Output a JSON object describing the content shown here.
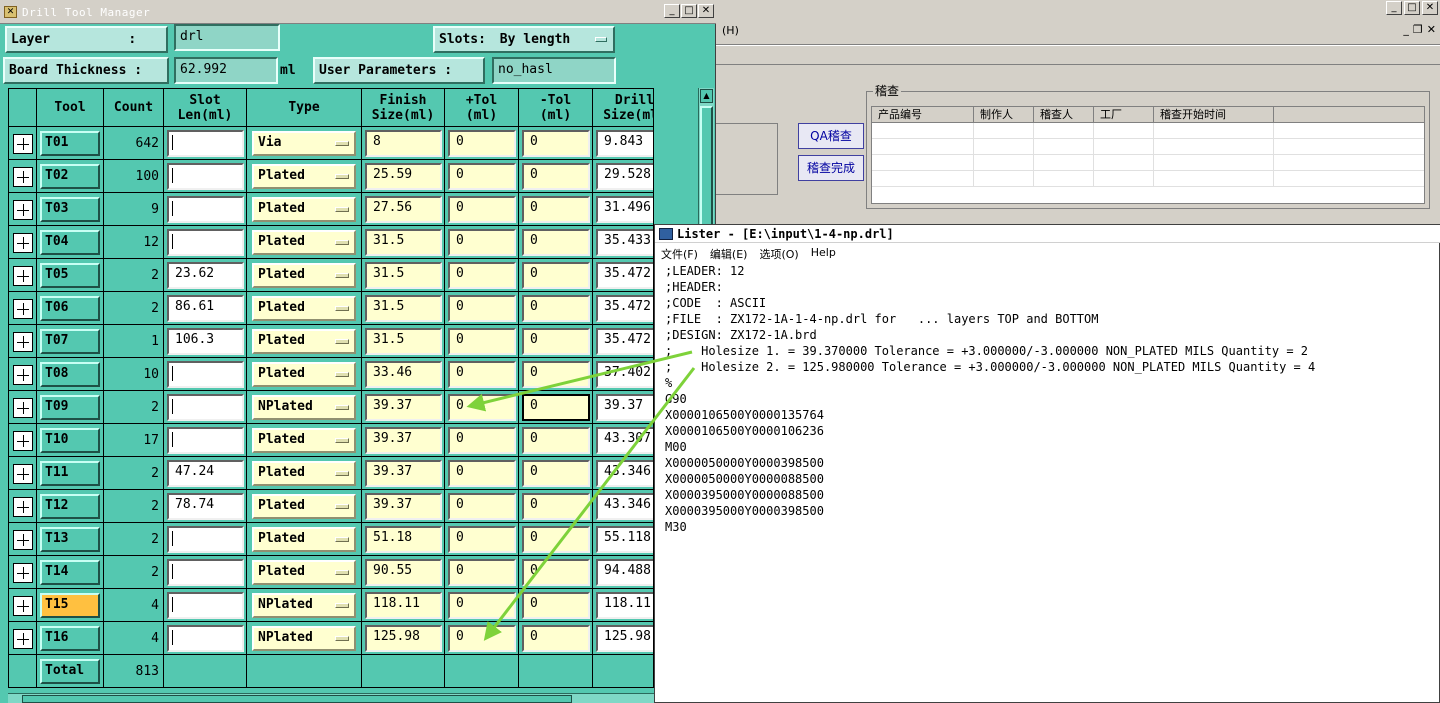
{
  "dtm": {
    "title": "Drill Tool Manager",
    "title_buttons": [
      "_",
      "□",
      "✕"
    ],
    "layer_label": "Layer          :",
    "layer_value": "drl",
    "slots_label": "Slots:",
    "slots_value": "By length",
    "board_thickness_label": "Board Thickness :",
    "board_thickness_value": "62.992",
    "board_thickness_unit": "ml",
    "user_params_label": "User Parameters :",
    "user_params_value": "no_hasl",
    "columns": {
      "tool": "Tool",
      "count": "Count",
      "slot_len": "Slot Len(ml)",
      "type": "Type",
      "finish_size": "Finish Size(ml)",
      "plus_tol": "+Tol (ml)",
      "minus_tol": "-Tol (ml)",
      "drill_size": "Drill Size(ml)"
    },
    "rows": [
      {
        "tool": "T01",
        "count": "642",
        "slot": "",
        "type": "Via",
        "finish": "8",
        "ptol": "0",
        "mtol": "0",
        "drill": "9.843"
      },
      {
        "tool": "T02",
        "count": "100",
        "slot": "",
        "type": "Plated",
        "finish": "25.59",
        "ptol": "0",
        "mtol": "0",
        "drill": "29.528"
      },
      {
        "tool": "T03",
        "count": "9",
        "slot": "",
        "type": "Plated",
        "finish": "27.56",
        "ptol": "0",
        "mtol": "0",
        "drill": "31.496"
      },
      {
        "tool": "T04",
        "count": "12",
        "slot": "",
        "type": "Plated",
        "finish": "31.5",
        "ptol": "0",
        "mtol": "0",
        "drill": "35.433"
      },
      {
        "tool": "T05",
        "count": "2",
        "slot": "23.62",
        "type": "Plated",
        "finish": "31.5",
        "ptol": "0",
        "mtol": "0",
        "drill": "35.472"
      },
      {
        "tool": "T06",
        "count": "2",
        "slot": "86.61",
        "type": "Plated",
        "finish": "31.5",
        "ptol": "0",
        "mtol": "0",
        "drill": "35.472"
      },
      {
        "tool": "T07",
        "count": "1",
        "slot": "106.3",
        "type": "Plated",
        "finish": "31.5",
        "ptol": "0",
        "mtol": "0",
        "drill": "35.472"
      },
      {
        "tool": "T08",
        "count": "10",
        "slot": "",
        "type": "Plated",
        "finish": "33.46",
        "ptol": "0",
        "mtol": "0",
        "drill": "37.402"
      },
      {
        "tool": "T09",
        "count": "2",
        "slot": "",
        "type": "NPlated",
        "finish": "39.37",
        "ptol": "0",
        "mtol": "0",
        "drill": "39.37"
      },
      {
        "tool": "T10",
        "count": "17",
        "slot": "",
        "type": "Plated",
        "finish": "39.37",
        "ptol": "0",
        "mtol": "0",
        "drill": "43.307"
      },
      {
        "tool": "T11",
        "count": "2",
        "slot": "47.24",
        "type": "Plated",
        "finish": "39.37",
        "ptol": "0",
        "mtol": "0",
        "drill": "43.346"
      },
      {
        "tool": "T12",
        "count": "2",
        "slot": "78.74",
        "type": "Plated",
        "finish": "39.37",
        "ptol": "0",
        "mtol": "0",
        "drill": "43.346"
      },
      {
        "tool": "T13",
        "count": "2",
        "slot": "",
        "type": "Plated",
        "finish": "51.18",
        "ptol": "0",
        "mtol": "0",
        "drill": "55.118"
      },
      {
        "tool": "T14",
        "count": "2",
        "slot": "",
        "type": "Plated",
        "finish": "90.55",
        "ptol": "0",
        "mtol": "0",
        "drill": "94.488"
      },
      {
        "tool": "T15",
        "count": "4",
        "slot": "",
        "type": "NPlated",
        "finish": "118.11",
        "ptol": "0",
        "mtol": "0",
        "drill": "118.11"
      },
      {
        "tool": "T16",
        "count": "4",
        "slot": "",
        "type": "NPlated",
        "finish": "125.98",
        "ptol": "0",
        "mtol": "0",
        "drill": "125.98"
      }
    ],
    "selected_tool": "T15",
    "total_label": "Total",
    "total_count": "813"
  },
  "bgapp": {
    "menu_fragment": "(H)",
    "window_buttons": [
      "_",
      "□",
      "✕"
    ],
    "mdi_buttons": [
      "_",
      "❐",
      "✕"
    ],
    "qa_button": "QA稽查",
    "done_button": "稽查完成",
    "group_title": "稽查",
    "grid_headers": [
      "产品编号",
      "制作人",
      "稽查人",
      "工厂",
      "稽查开始时间"
    ]
  },
  "lister": {
    "title": "Lister - [E:\\input\\1-4-np.drl]",
    "menu": [
      "文件(F)",
      "编辑(E)",
      "选项(O)",
      "Help"
    ],
    "lines": [
      ";LEADER: 12",
      ";HEADER:",
      ";CODE  : ASCII",
      ";FILE  : ZX172-1A-1-4-np.drl for   ... layers TOP and BOTTOM",
      ";DESIGN: ZX172-1A.brd",
      ";    Holesize 1. = 39.370000 Tolerance = +3.000000/-3.000000 NON_PLATED MILS Quantity = 2",
      ";    Holesize 2. = 125.980000 Tolerance = +3.000000/-3.000000 NON_PLATED MILS Quantity = 4",
      "%",
      "G90",
      "X0000106500Y0000135764",
      "X0000106500Y0000106236",
      "M00",
      "X0000050000Y0000398500",
      "X0000050000Y0000088500",
      "X0000395000Y0000088500",
      "X0000395000Y0000398500",
      "M30"
    ]
  },
  "colors": {
    "panel": "#54c8b0",
    "yellow_field": "#ffffd0",
    "selected": "#ffc040",
    "arrow": "#7ed23a"
  }
}
